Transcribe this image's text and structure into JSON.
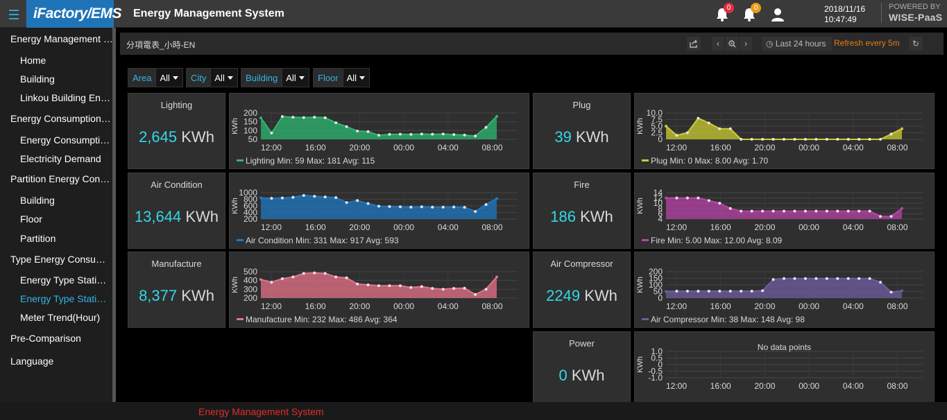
{
  "header": {
    "logo": "iFactory/EMS",
    "title": "Energy Management System",
    "notifications": [
      {
        "icon": "bell-icon",
        "count": "0",
        "color": "#e02f44"
      },
      {
        "icon": "bell-icon",
        "count": "0",
        "color": "#eb9b18"
      }
    ],
    "date": "2018/11/16",
    "time": "10:47:49",
    "powered_by": "POWERED BY",
    "brand": "WISE-PaaS"
  },
  "sidebar": {
    "items": [
      {
        "label": "Energy Management S...",
        "level": 0
      },
      {
        "label": "Home",
        "level": 1
      },
      {
        "label": "Building",
        "level": 1
      },
      {
        "label": "Linkou Building Ener...",
        "level": 1
      },
      {
        "label": "Energy Consumption I...",
        "level": 0
      },
      {
        "label": "Energy Consumptio...",
        "level": 1
      },
      {
        "label": "Electricity Demand",
        "level": 1
      },
      {
        "label": "Partition Energy Consu...",
        "level": 0
      },
      {
        "label": "Building",
        "level": 1
      },
      {
        "label": "Floor",
        "level": 1
      },
      {
        "label": "Partition",
        "level": 1
      },
      {
        "label": "Type Energy Consump...",
        "level": 0
      },
      {
        "label": "Energy Type Statisti...",
        "level": 1
      },
      {
        "label": "Energy Type Statisti...",
        "level": 1,
        "active": true
      },
      {
        "label": "Meter Trend(Hour)",
        "level": 1
      },
      {
        "label": "Pre-Comparison",
        "level": 0
      },
      {
        "label": "Language",
        "level": 0
      }
    ]
  },
  "dashboard": {
    "title": "分項電表_小時-EN",
    "time_range": "Last 24 hours",
    "refresh": "Refresh every 5m"
  },
  "filters": [
    {
      "label": "Area",
      "value": "All"
    },
    {
      "label": "City",
      "value": "All"
    },
    {
      "label": "Building",
      "value": "All"
    },
    {
      "label": "Floor",
      "value": "All"
    }
  ],
  "units": "KWh",
  "x_ticks": [
    "12:00",
    "16:00",
    "20:00",
    "00:00",
    "04:00",
    "08:00"
  ],
  "stats": [
    {
      "title": "Lighting",
      "value": "2,645",
      "unit": "KWh"
    },
    {
      "title": "Air Condition",
      "value": "13,644",
      "unit": "KWh"
    },
    {
      "title": "Manufacture",
      "value": "8,377",
      "unit": "KWh"
    },
    {
      "title": "Plug",
      "value": "39",
      "unit": "KWh"
    },
    {
      "title": "Fire",
      "value": "186",
      "unit": "KWh"
    },
    {
      "title": "Air Compressor",
      "value": "2249",
      "unit": "KWh"
    },
    {
      "title": "Power",
      "value": "0",
      "unit": "KWh"
    }
  ],
  "chart_data": [
    {
      "type": "area",
      "name": "Lighting",
      "color": "#2eb872",
      "ylabel": "KWh",
      "yticks": [
        "200",
        "150",
        "100",
        "50"
      ],
      "ylim": [
        50,
        200
      ],
      "x": [
        "11:00",
        "12:00",
        "13:00",
        "14:00",
        "15:00",
        "16:00",
        "17:00",
        "18:00",
        "19:00",
        "20:00",
        "21:00",
        "22:00",
        "23:00",
        "00:00",
        "01:00",
        "02:00",
        "03:00",
        "04:00",
        "05:00",
        "06:00",
        "07:00",
        "08:00",
        "09:00"
      ],
      "values": [
        172,
        86,
        180,
        176,
        174,
        176,
        173,
        144,
        122,
        97,
        94,
        73,
        78,
        79,
        78,
        80,
        79,
        80,
        77,
        74,
        69,
        118,
        181
      ],
      "legend": "Lighting Min: 59 Max: 181 Avg: 115"
    },
    {
      "type": "area",
      "name": "Air Condition",
      "color": "#1f78c1",
      "ylabel": "KWh",
      "yticks": [
        "1000",
        "800",
        "600",
        "400",
        "200"
      ],
      "ylim": [
        200,
        1000
      ],
      "x": [
        "11:00",
        "12:00",
        "13:00",
        "14:00",
        "15:00",
        "16:00",
        "17:00",
        "18:00",
        "19:00",
        "20:00",
        "21:00",
        "22:00",
        "23:00",
        "00:00",
        "01:00",
        "02:00",
        "03:00",
        "04:00",
        "05:00",
        "06:00",
        "07:00",
        "08:00",
        "09:00"
      ],
      "values": [
        840,
        830,
        840,
        860,
        917,
        890,
        870,
        850,
        700,
        760,
        670,
        590,
        580,
        570,
        560,
        570,
        560,
        560,
        565,
        555,
        430,
        640,
        820
      ],
      "legend": "Air Condition Min: 331 Max: 917 Avg: 593"
    },
    {
      "type": "area",
      "name": "Manufacture",
      "color": "#e5738a",
      "ylabel": "KWh",
      "yticks": [
        "500",
        "400",
        "300",
        "200"
      ],
      "ylim": [
        200,
        500
      ],
      "x": [
        "11:00",
        "12:00",
        "13:00",
        "14:00",
        "15:00",
        "16:00",
        "17:00",
        "18:00",
        "19:00",
        "20:00",
        "21:00",
        "22:00",
        "23:00",
        "00:00",
        "01:00",
        "02:00",
        "03:00",
        "04:00",
        "05:00",
        "06:00",
        "07:00",
        "08:00",
        "09:00"
      ],
      "values": [
        410,
        380,
        420,
        440,
        480,
        486,
        480,
        440,
        430,
        360,
        350,
        340,
        340,
        340,
        320,
        330,
        310,
        300,
        310,
        312,
        240,
        300,
        440
      ],
      "legend": "Manufacture Min: 232 Max: 486 Avg: 364"
    },
    {
      "type": "area",
      "name": "Plug",
      "color": "#cccc33",
      "ylabel": "KWh",
      "yticks": [
        "10.0",
        "7.5",
        "5.0",
        "2.5",
        "0"
      ],
      "ylim": [
        0,
        10
      ],
      "x": [
        "11:00",
        "12:00",
        "13:00",
        "14:00",
        "15:00",
        "16:00",
        "17:00",
        "18:00",
        "19:00",
        "20:00",
        "21:00",
        "22:00",
        "23:00",
        "00:00",
        "01:00",
        "02:00",
        "03:00",
        "04:00",
        "05:00",
        "06:00",
        "07:00",
        "08:00",
        "09:00"
      ],
      "values": [
        5,
        1.5,
        2.5,
        8,
        6.2,
        4,
        4,
        0,
        0,
        0,
        0,
        0,
        0,
        0,
        0,
        0,
        0,
        0,
        0,
        0,
        0,
        2,
        4
      ],
      "legend": "Plug Min: 0 Max: 8.00 Avg: 1.70"
    },
    {
      "type": "area",
      "name": "Fire",
      "color": "#ba43a9",
      "ylabel": "KWh",
      "yticks": [
        "14",
        "12",
        "10",
        "8",
        "6",
        "4"
      ],
      "ylim": [
        4,
        14
      ],
      "x": [
        "11:00",
        "12:00",
        "13:00",
        "14:00",
        "15:00",
        "16:00",
        "17:00",
        "18:00",
        "19:00",
        "20:00",
        "21:00",
        "22:00",
        "23:00",
        "00:00",
        "01:00",
        "02:00",
        "03:00",
        "04:00",
        "05:00",
        "06:00",
        "07:00",
        "08:00",
        "09:00"
      ],
      "values": [
        12,
        12,
        12,
        12,
        11,
        10,
        8,
        7,
        7,
        7,
        7,
        7,
        7,
        7,
        7,
        7,
        7,
        7,
        7,
        7,
        5,
        5,
        8
      ],
      "legend": "Fire Min: 5.00 Max: 12.00 Avg: 8.09"
    },
    {
      "type": "area",
      "name": "Air Compressor",
      "color": "#705da0",
      "ylabel": "KWh",
      "yticks": [
        "200",
        "150",
        "100",
        "50",
        "0"
      ],
      "ylim": [
        0,
        200
      ],
      "x": [
        "11:00",
        "12:00",
        "13:00",
        "14:00",
        "15:00",
        "16:00",
        "17:00",
        "18:00",
        "19:00",
        "20:00",
        "21:00",
        "22:00",
        "23:00",
        "00:00",
        "01:00",
        "02:00",
        "03:00",
        "04:00",
        "05:00",
        "06:00",
        "07:00",
        "08:00",
        "09:00"
      ],
      "values": [
        50,
        52,
        52,
        52,
        52,
        52,
        52,
        52,
        52,
        55,
        140,
        148,
        148,
        148,
        148,
        148,
        148,
        148,
        148,
        148,
        120,
        45,
        55
      ],
      "legend": "Air Compressor Min: 38 Max: 148 Avg: 98"
    },
    {
      "type": "line",
      "name": "Power",
      "color": "#7eb26d",
      "ylabel": "KWh",
      "yticks": [
        "1.0",
        "0.5",
        "0",
        "-0.5",
        "-1.0"
      ],
      "ylim": [
        -1,
        1
      ],
      "x": [],
      "values": [],
      "legend": "",
      "nodata": "No data points"
    }
  ],
  "footer": "Energy Management System"
}
